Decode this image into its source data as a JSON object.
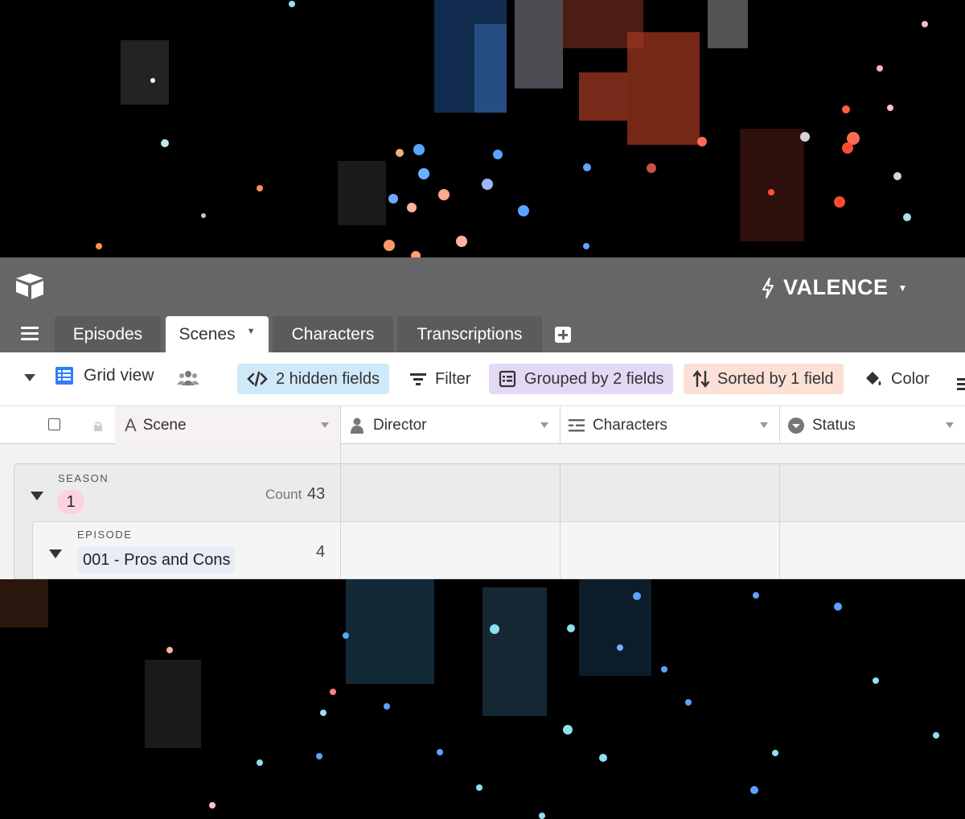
{
  "base": {
    "name": "VALENCE"
  },
  "tabs": [
    {
      "label": "Episodes"
    },
    {
      "label": "Scenes"
    },
    {
      "label": "Characters"
    },
    {
      "label": "Transcriptions"
    }
  ],
  "view": {
    "name": "Grid view",
    "hidden_fields_label": "2 hidden fields",
    "filter_label": "Filter",
    "group_label": "Grouped by 2 fields",
    "sort_label": "Sorted by 1 field",
    "color_label": "Color"
  },
  "columns": [
    {
      "label": "Scene"
    },
    {
      "label": "Director"
    },
    {
      "label": "Characters"
    },
    {
      "label": "Status"
    }
  ],
  "groups": {
    "season": {
      "heading": "SEASON",
      "value": "1",
      "count_label": "Count",
      "count": "43"
    },
    "episode": {
      "heading": "EPISODE",
      "value": "001 - Pros and Cons",
      "count": "4"
    }
  },
  "colors": {
    "topbar": "#666666",
    "hidden_fields_bg": "#cfe9f8",
    "group_bg": "#e4d9f5",
    "sort_bg": "#fbe0d5",
    "season_badge": "#fbd3df",
    "episode_chip": "#e8ecf7",
    "grid_icon": "#2d7ff9"
  },
  "icons": [
    "airtable-logo-icon",
    "lightning-icon",
    "menu-icon",
    "add-table-icon",
    "grid-view-icon",
    "people-icon",
    "hidden-fields-icon",
    "filter-icon",
    "group-icon",
    "sort-icon",
    "paint-bucket-icon",
    "lock-icon",
    "text-field-icon",
    "user-field-icon",
    "multiple-field-icon",
    "single-select-icon"
  ]
}
